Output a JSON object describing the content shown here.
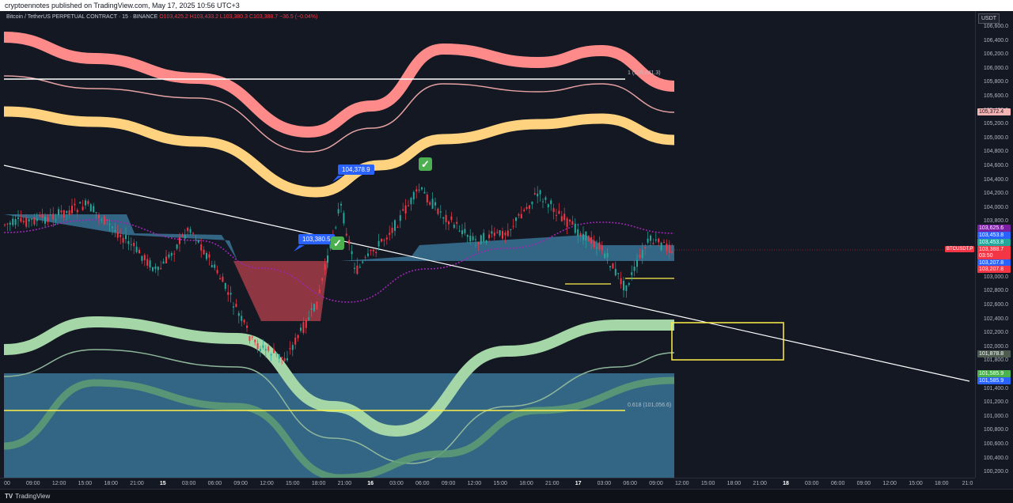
{
  "header": {
    "publisher_line": "cryptoennotes published on TradingView.com, May 17, 2025 10:56 UTC+3"
  },
  "legend": {
    "symbol": "Bitcoin / TetherUS PERPETUAL CONTRACT · 15 · BINANCE",
    "open": "O103,425.2",
    "high": "H103,433.2",
    "low": "L103,380.3",
    "close": "C103,388.7",
    "change": "−36.5 (−0.04%)"
  },
  "currency_button": "USDT",
  "price_ticks": [
    "106,600.0",
    "106,400.0",
    "106,200.0",
    "106,000.0",
    "105,800.0",
    "105,600.0",
    "105,400.0",
    "105,200.0",
    "105,000.0",
    "104,800.0",
    "104,600.0",
    "104,400.0",
    "104,200.0",
    "104,000.0",
    "103,800.0",
    "103,600.0",
    "103,400.0",
    "103,200.0",
    "103,000.0",
    "102,800.0",
    "102,600.0",
    "102,400.0",
    "102,200.0",
    "102,000.0",
    "101,800.0",
    "101,600.0",
    "101,400.0",
    "101,200.0",
    "101,000.0",
    "100,800.0",
    "100,600.0",
    "100,400.0",
    "100,200.0"
  ],
  "price_badges": [
    {
      "label": "105,372.4",
      "color": "#f5b4b4",
      "text": "#131722"
    },
    {
      "label": "103,625.6",
      "color": "#7b1fa2",
      "text": "#ffffff"
    },
    {
      "label": "103,453.8",
      "color": "#2962ff",
      "text": "#ffffff"
    },
    {
      "label": "103,453.8",
      "color": "#26a69a",
      "text": "#ffffff"
    },
    {
      "label": "103,388.7",
      "color": "#f23645",
      "text": "#ffffff"
    },
    {
      "label": "03:50",
      "color": "#f23645",
      "text": "#ffffff"
    },
    {
      "label": "103,207.8",
      "color": "#2962ff",
      "text": "#ffffff"
    },
    {
      "label": "103,207.8",
      "color": "#f23645",
      "text": "#ffffff"
    },
    {
      "label": "101,878.8",
      "color": "#4e5b50",
      "text": "#ffffff"
    },
    {
      "label": "101,585.9",
      "color": "#4caf50",
      "text": "#ffffff"
    },
    {
      "label": "101,585.9",
      "color": "#2962ff",
      "text": "#ffffff"
    }
  ],
  "symbol_tag": "BTCUSDT.P",
  "time_labels": [
    {
      "t": "00",
      "b": false
    },
    {
      "t": "09:00",
      "b": false
    },
    {
      "t": "12:00",
      "b": false
    },
    {
      "t": "15:00",
      "b": false
    },
    {
      "t": "18:00",
      "b": false
    },
    {
      "t": "21:00",
      "b": false
    },
    {
      "t": "15",
      "b": true
    },
    {
      "t": "03:00",
      "b": false
    },
    {
      "t": "06:00",
      "b": false
    },
    {
      "t": "09:00",
      "b": false
    },
    {
      "t": "12:00",
      "b": false
    },
    {
      "t": "15:00",
      "b": false
    },
    {
      "t": "18:00",
      "b": false
    },
    {
      "t": "21:00",
      "b": false
    },
    {
      "t": "16",
      "b": true
    },
    {
      "t": "03:00",
      "b": false
    },
    {
      "t": "06:00",
      "b": false
    },
    {
      "t": "09:00",
      "b": false
    },
    {
      "t": "12:00",
      "b": false
    },
    {
      "t": "15:00",
      "b": false
    },
    {
      "t": "18:00",
      "b": false
    },
    {
      "t": "21:00",
      "b": false
    },
    {
      "t": "17",
      "b": true
    },
    {
      "t": "03:00",
      "b": false
    },
    {
      "t": "06:00",
      "b": false
    },
    {
      "t": "09:00",
      "b": false
    },
    {
      "t": "12:00",
      "b": false
    },
    {
      "t": "15:00",
      "b": false
    },
    {
      "t": "18:00",
      "b": false
    },
    {
      "t": "21:00",
      "b": false
    },
    {
      "t": "18",
      "b": true
    },
    {
      "t": "03:00",
      "b": false
    },
    {
      "t": "06:00",
      "b": false
    },
    {
      "t": "09:00",
      "b": false
    },
    {
      "t": "12:00",
      "b": false
    },
    {
      "t": "15:00",
      "b": false
    },
    {
      "t": "18:00",
      "b": false
    },
    {
      "t": "21:0",
      "b": false
    }
  ],
  "callouts": {
    "high_callout": "104,378.9",
    "entry_callout": "103,380.5"
  },
  "fib_labels": {
    "fib_1": "1 (105,841.3)",
    "fib_618": "0.618 (101,056.6)"
  },
  "footer": {
    "brand": "TradingView",
    "logo": "TV"
  },
  "colors": {
    "bull": "#26a69a",
    "bear": "#f23645",
    "upper_band": "#ff8a8a",
    "mid_band": "#ffd27f",
    "lower_band": "#a5d6a7",
    "cloud": "#3d7fa6"
  }
}
